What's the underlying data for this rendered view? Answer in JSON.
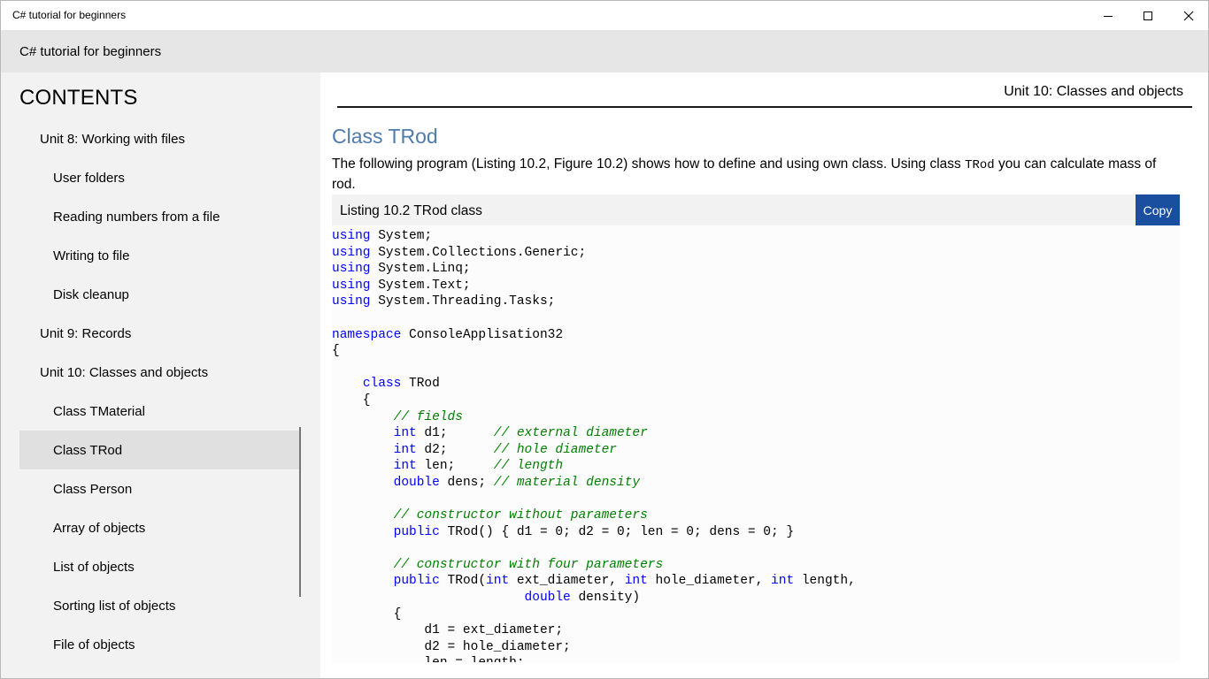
{
  "window": {
    "title": "C# tutorial for beginners",
    "controls": {
      "minimize": "minimize-icon",
      "maximize": "maximize-icon",
      "close": "close-icon"
    }
  },
  "header": {
    "title": "C# tutorial for beginners"
  },
  "sidebar": {
    "heading": "CONTENTS",
    "items": [
      {
        "label": "Unit 8: Working with files",
        "level": 1
      },
      {
        "label": "User folders",
        "level": 2
      },
      {
        "label": "Reading numbers from a file",
        "level": 2
      },
      {
        "label": "Writing to file",
        "level": 2
      },
      {
        "label": "Disk cleanup",
        "level": 2
      },
      {
        "label": "Unit 9: Records",
        "level": 1
      },
      {
        "label": "Unit 10: Classes and objects",
        "level": 1
      },
      {
        "label": "Class TMaterial",
        "level": 2
      },
      {
        "label": "Class TRod",
        "level": 2,
        "selected": true
      },
      {
        "label": "Class Person",
        "level": 2
      },
      {
        "label": "Array of objects",
        "level": 2
      },
      {
        "label": "List of objects",
        "level": 2
      },
      {
        "label": "Sorting list of objects",
        "level": 2
      },
      {
        "label": "File of objects",
        "level": 2
      }
    ]
  },
  "main": {
    "breadcrumb": "Unit 10: Classes and objects",
    "title": "Class TRod",
    "intro_before": "The following program (Listing 10.2, Figure 10.2) shows how to define and using own class. Using class ",
    "intro_code": "TRod",
    "intro_after": " you can calculate mass of rod.",
    "listing_label": "Listing 10.2 TRod class",
    "copy_label": "Copy",
    "code_lines": [
      [
        {
          "t": "using",
          "k": "kw"
        },
        {
          "t": " System;"
        }
      ],
      [
        {
          "t": "using",
          "k": "kw"
        },
        {
          "t": " System.Collections.Generic;"
        }
      ],
      [
        {
          "t": "using",
          "k": "kw"
        },
        {
          "t": " System.Linq;"
        }
      ],
      [
        {
          "t": "using",
          "k": "kw"
        },
        {
          "t": " System.Text;"
        }
      ],
      [
        {
          "t": "using",
          "k": "kw"
        },
        {
          "t": " System.Threading.Tasks;"
        }
      ],
      [],
      [
        {
          "t": "namespace",
          "k": "kw"
        },
        {
          "t": " ConsoleApplisation32"
        }
      ],
      [
        {
          "t": "{"
        }
      ],
      [],
      [
        {
          "t": "    "
        },
        {
          "t": "class",
          "k": "kw"
        },
        {
          "t": " TRod"
        }
      ],
      [
        {
          "t": "    {"
        }
      ],
      [
        {
          "t": "        "
        },
        {
          "t": "// fields",
          "k": "cm"
        }
      ],
      [
        {
          "t": "        "
        },
        {
          "t": "int",
          "k": "kw"
        },
        {
          "t": " d1;      "
        },
        {
          "t": "// external diameter",
          "k": "cm"
        }
      ],
      [
        {
          "t": "        "
        },
        {
          "t": "int",
          "k": "kw"
        },
        {
          "t": " d2;      "
        },
        {
          "t": "// hole diameter",
          "k": "cm"
        }
      ],
      [
        {
          "t": "        "
        },
        {
          "t": "int",
          "k": "kw"
        },
        {
          "t": " len;     "
        },
        {
          "t": "// length",
          "k": "cm"
        }
      ],
      [
        {
          "t": "        "
        },
        {
          "t": "double",
          "k": "kw"
        },
        {
          "t": " dens; "
        },
        {
          "t": "// material density",
          "k": "cm"
        }
      ],
      [],
      [
        {
          "t": "        "
        },
        {
          "t": "// constructor without parameters",
          "k": "cm"
        }
      ],
      [
        {
          "t": "        "
        },
        {
          "t": "public",
          "k": "kw"
        },
        {
          "t": " TRod() { d1 = 0; d2 = 0; len = 0; dens = 0; }"
        }
      ],
      [],
      [
        {
          "t": "        "
        },
        {
          "t": "// constructor with four parameters",
          "k": "cm"
        }
      ],
      [
        {
          "t": "        "
        },
        {
          "t": "public",
          "k": "kw"
        },
        {
          "t": " TRod("
        },
        {
          "t": "int",
          "k": "kw"
        },
        {
          "t": " ext_diameter, "
        },
        {
          "t": "int",
          "k": "kw"
        },
        {
          "t": " hole_diameter, "
        },
        {
          "t": "int",
          "k": "kw"
        },
        {
          "t": " length,"
        }
      ],
      [
        {
          "t": "                         "
        },
        {
          "t": "double",
          "k": "kw"
        },
        {
          "t": " density)"
        }
      ],
      [
        {
          "t": "        {"
        }
      ],
      [
        {
          "t": "            d1 = ext_diameter;"
        }
      ],
      [
        {
          "t": "            d2 = hole_diameter;"
        }
      ],
      [
        {
          "t": "            len = length;"
        }
      ]
    ]
  },
  "colors": {
    "accent_title": "#4f7bad",
    "copy_button": "#1a4fa0",
    "keyword": "#0000ff",
    "comment": "#008000"
  }
}
